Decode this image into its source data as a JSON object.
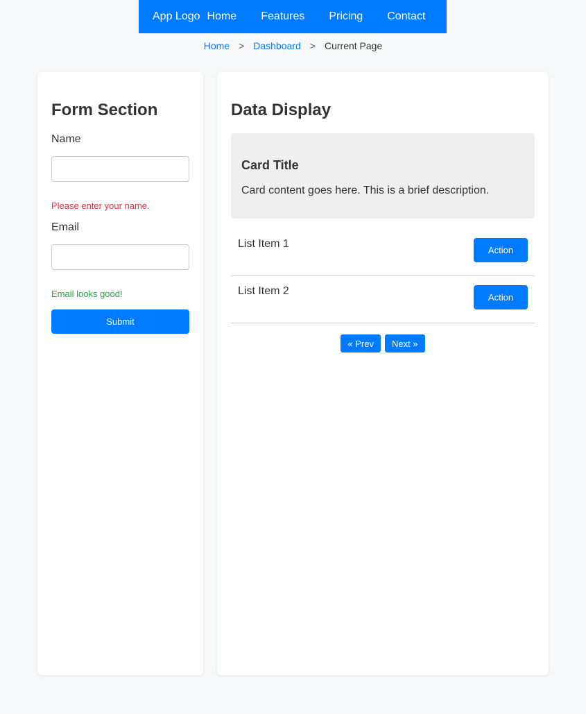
{
  "navbar": {
    "logo": "App Logo",
    "links": [
      "Home",
      "Features",
      "Pricing",
      "Contact"
    ]
  },
  "breadcrumb": {
    "items": [
      "Home",
      "Dashboard"
    ],
    "separator": ">",
    "current": "Current Page"
  },
  "form": {
    "title": "Form Section",
    "name_label": "Name",
    "name_value": "",
    "name_error": "Please enter your name.",
    "email_label": "Email",
    "email_value": "",
    "email_ok": "Email looks good!",
    "submit_label": "Submit"
  },
  "data_display": {
    "title": "Data Display",
    "card": {
      "title": "Card Title",
      "text": "Card content goes here. This is a brief description."
    },
    "list": [
      {
        "label": "List Item 1",
        "action": "Action"
      },
      {
        "label": "List Item 2",
        "action": "Action"
      }
    ],
    "pagination": {
      "prev": "« Prev",
      "next": "Next »"
    }
  },
  "colors": {
    "accent": "#007bff",
    "error": "#dc3545",
    "success": "#28a745",
    "card_bg": "#efefef"
  }
}
